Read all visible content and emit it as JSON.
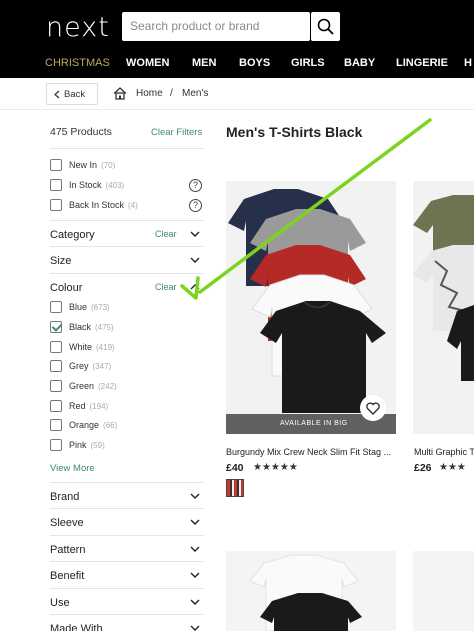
{
  "header": {
    "logo": "next",
    "search_placeholder": "Search product or brand",
    "nav": [
      "CHRISTMAS",
      "WOMEN",
      "MEN",
      "BOYS",
      "GIRLS",
      "BABY",
      "LINGERIE",
      "H"
    ]
  },
  "breadcrumb": {
    "back_label": "Back",
    "home_label": "Home",
    "separator": "/",
    "current": "Men's"
  },
  "sidebar": {
    "product_count": "475 Products",
    "clear_filters": "Clear Filters",
    "availability": [
      {
        "label": "New In",
        "count": "(70)"
      },
      {
        "label": "In Stock",
        "count": "(403)"
      },
      {
        "label": "Back In Stock",
        "count": "(4)"
      }
    ],
    "sections_top": [
      {
        "title": "Category",
        "clear": "Clear"
      },
      {
        "title": "Size",
        "clear": ""
      },
      {
        "title": "Colour",
        "clear": "Clear"
      }
    ],
    "colours": [
      {
        "label": "Blue",
        "count": "(673)",
        "checked": false
      },
      {
        "label": "Black",
        "count": "(475)",
        "checked": true
      },
      {
        "label": "White",
        "count": "(419)",
        "checked": false
      },
      {
        "label": "Grey",
        "count": "(347)",
        "checked": false
      },
      {
        "label": "Green",
        "count": "(242)",
        "checked": false
      },
      {
        "label": "Red",
        "count": "(194)",
        "checked": false
      },
      {
        "label": "Orange",
        "count": "(66)",
        "checked": false
      },
      {
        "label": "Pink",
        "count": "(59)",
        "checked": false
      }
    ],
    "view_more": "View More",
    "sections_bottom": [
      "Brand",
      "Sleeve",
      "Pattern",
      "Benefit",
      "Use",
      "Made With"
    ]
  },
  "main": {
    "title": "Men's T-Shirts Black",
    "products": [
      {
        "name": "Burgundy Mix Crew Neck Slim Fit Stag ...",
        "price": "£40",
        "stars": "★★★★★",
        "badge": "AVAILABLE IN BIG"
      },
      {
        "name": "Multi Graphic T...",
        "price": "£26",
        "stars": "★★★"
      }
    ]
  },
  "colors": {
    "accent": "#3f8d67",
    "christmas": "#c2a46b",
    "arrow": "#7ed321"
  }
}
